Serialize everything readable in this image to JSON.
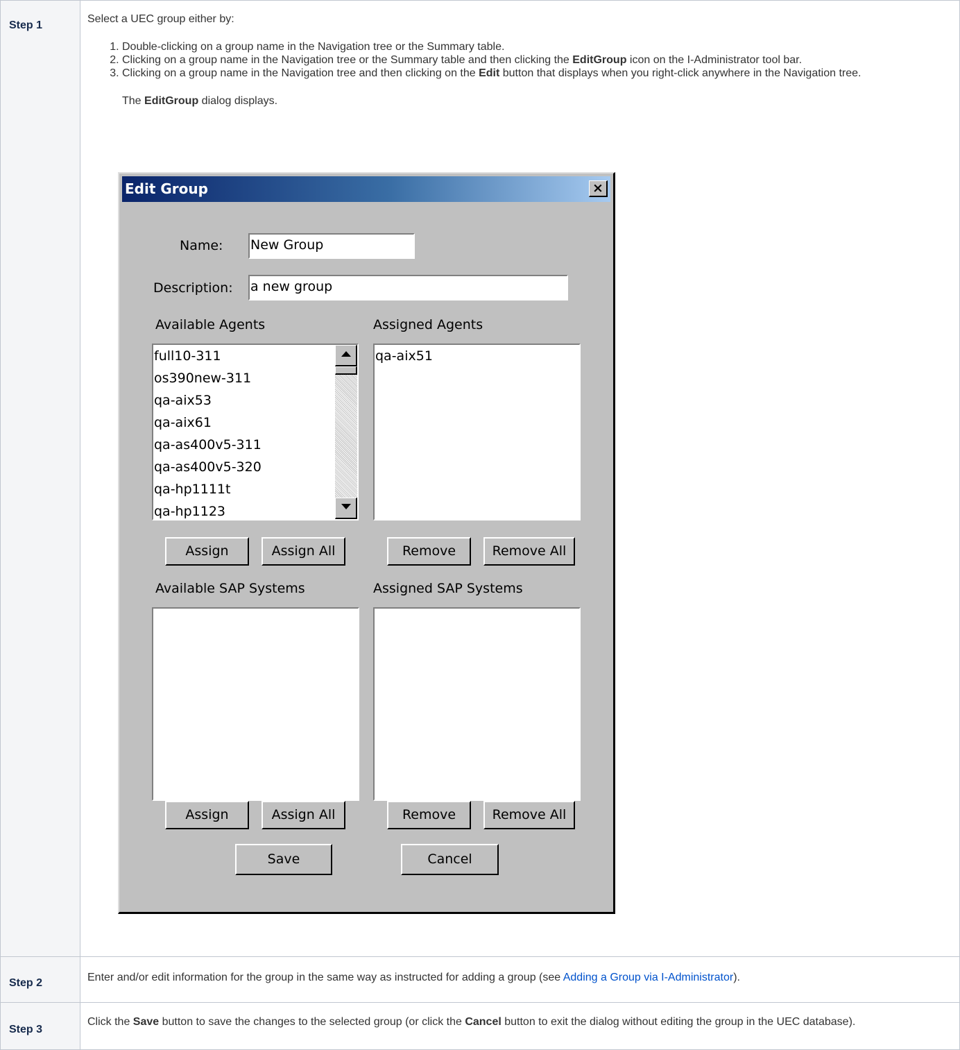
{
  "steps": [
    {
      "label": "Step 1",
      "intro": "Select a UEC group either by:",
      "list": [
        {
          "a": "Double-clicking on a group name in the Navigation tree or the Summary table.",
          "bold": "",
          "b": ""
        },
        {
          "a": "Clicking on a group name in the Navigation tree or the Summary table and then clicking the ",
          "bold": "EditGroup",
          "b": " icon on the I-Administrator tool bar."
        },
        {
          "a": "Clicking on a group name in the Navigation tree and then clicking on the ",
          "bold": "Edit",
          "b": " button that displays when you right-click anywhere in the Navigation tree."
        }
      ],
      "dialog_note_a": "The ",
      "dialog_note_bold": "EditGroup",
      "dialog_note_b": " dialog displays."
    },
    {
      "label": "Step 2",
      "text_a": "Enter and/or edit information for the group in the same way as instructed for adding a group (see ",
      "link": "Adding a Group via I-Administrator",
      "text_b": ")."
    },
    {
      "label": "Step 3",
      "text_a": "Click the ",
      "bold1": "Save",
      "text_b": " button to save the changes to the selected group (or click the ",
      "bold2": "Cancel",
      "text_c": " button to exit the dialog without editing the group in the UEC database)."
    }
  ],
  "dialog": {
    "title": "Edit Group",
    "close_glyph": "×",
    "name_label": "Name:",
    "name_value": "New Group",
    "description_label": "Description:",
    "description_value": "a new group",
    "available_agents_label": "Available Agents",
    "assigned_agents_label": "Assigned Agents",
    "available_agents": [
      "full10-311",
      "os390new-311",
      "qa-aix53",
      "qa-aix61",
      "qa-as400v5-311",
      "qa-as400v5-320",
      "qa-hp1111t",
      "qa-hp1123"
    ],
    "assigned_agents": [
      "qa-aix51"
    ],
    "available_sap_label": "Available SAP Systems",
    "assigned_sap_label": "Assigned SAP Systems",
    "assign_label": "Assign",
    "assign_all_label": "Assign All",
    "remove_label": "Remove",
    "remove_all_label": "Remove All",
    "save_label": "Save",
    "cancel_label": "Cancel"
  }
}
